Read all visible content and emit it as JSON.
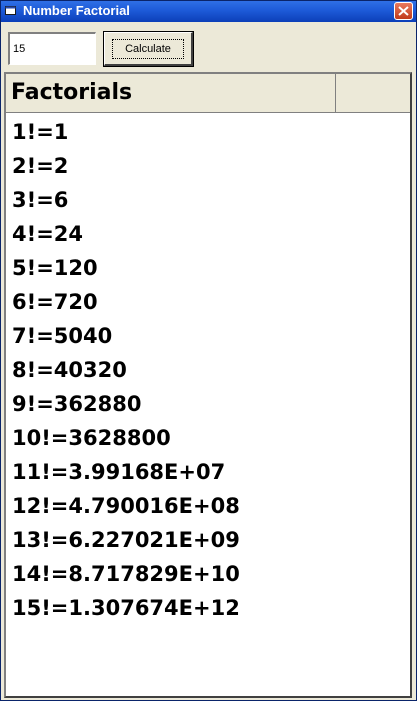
{
  "window": {
    "title": "Number Factorial",
    "icon": "app-icon",
    "close_icon": "close-icon"
  },
  "toolbar": {
    "number_input_value": "15",
    "calculate_label": "Calculate"
  },
  "grid": {
    "header": "Factorials",
    "rows": [
      "1!=1",
      "2!=2",
      "3!=6",
      "4!=24",
      "5!=120",
      "6!=720",
      "7!=5040",
      "8!=40320",
      "9!=362880",
      "10!=3628800",
      "11!=3.99168E+07",
      "12!=4.790016E+08",
      "13!=6.227021E+09",
      "14!=8.717829E+10",
      "15!=1.307674E+12"
    ]
  },
  "colors": {
    "titlebar": "#1d5ad8",
    "window_bg": "#ece9d8",
    "close_button": "#c13a1b"
  }
}
